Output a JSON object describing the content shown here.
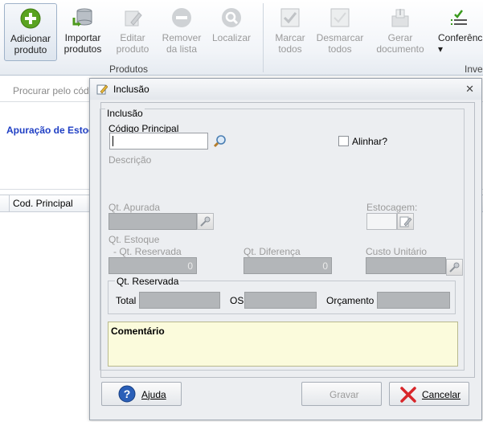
{
  "ribbon": {
    "buttons": [
      {
        "label": "Adicionar\nproduto",
        "icon": "add-circle-icon",
        "state": "active"
      },
      {
        "label": "Importar\nprodutos",
        "icon": "database-import-icon",
        "state": "enabled"
      },
      {
        "label": "Editar\nproduto",
        "icon": "edit-pencil-icon",
        "state": "disabled"
      },
      {
        "label": "Remover\nda lista",
        "icon": "remove-circle-icon",
        "state": "disabled"
      },
      {
        "label": "Localizar",
        "icon": "search-icon",
        "state": "disabled"
      },
      {
        "label": "Marcar\ntodos",
        "icon": "check-all-icon",
        "state": "disabled"
      },
      {
        "label": "Desmarcar\ntodos",
        "icon": "uncheck-all-icon",
        "state": "disabled"
      },
      {
        "label": "Gerar\ndocumento",
        "icon": "generate-document-icon",
        "state": "disabled"
      },
      {
        "label": "Conferênc\n▾",
        "icon": "checklist-icon",
        "state": "enabled"
      }
    ],
    "groups": {
      "produtos": "Produtos",
      "inventario": "Inve"
    }
  },
  "background": {
    "search_placeholder": "Procurar pelo cód",
    "section_title": "Apuração de Estoq",
    "column_header": "Cod. Principal"
  },
  "dialog": {
    "title": "Inclusão",
    "close_glyph": "✕",
    "group_title": "Inclusão",
    "codigo_label": "Código Principal",
    "codigo_value": "",
    "alinhar_label": "Alinhar?",
    "descricao_label": "Descrição",
    "qt_apurada_label": "Qt. Apurada",
    "estocagem_label": "Estocagem:",
    "qt_estoque_label": "Qt. Estoque",
    "qt_reservada_sub_label": "- Qt. Reservada",
    "qt_estoque_value": "0",
    "qt_diferenca_label": "Qt. Diferença",
    "qt_diferenca_value": "0",
    "custo_unitario_label": "Custo Unitário",
    "reservada_group_title": "Qt. Reservada",
    "total_label": "Total",
    "os_label": "OS",
    "orcamento_label": "Orçamento",
    "comentario_label": "Comentário",
    "buttons": {
      "ajuda": "Ajuda",
      "gravar": "Gravar",
      "cancelar": "Cancelar"
    }
  },
  "colors": {
    "accent_blue": "#1f3fc4",
    "add_green": "#5aa321",
    "cancel_red": "#d8262a",
    "comment_bg": "#fbfbdc"
  }
}
